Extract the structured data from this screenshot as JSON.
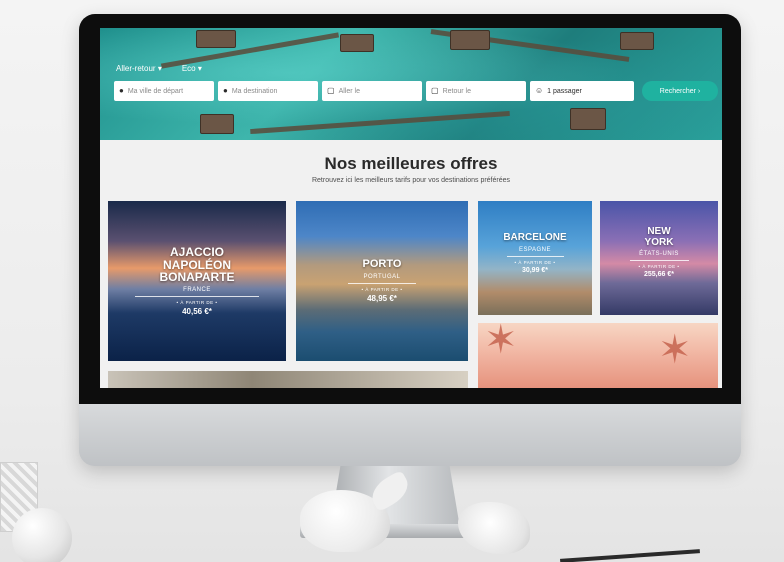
{
  "search": {
    "trip_type": "Aller-retour",
    "trip_type_caret": "▾",
    "cabin": "Eco",
    "cabin_caret": "▾",
    "departure_placeholder": "Ma ville de départ",
    "destination_placeholder": "Ma destination",
    "outbound_placeholder": "Aller le",
    "return_placeholder": "Retour le",
    "passengers": "1 passager",
    "button": "Rechercher ›",
    "icons": {
      "departure": "map-pin-icon",
      "destination": "map-pin-icon",
      "outbound": "calendar-icon",
      "return": "calendar-icon",
      "passengers": "users-icon"
    }
  },
  "offers": {
    "title": "Nos meilleures offres",
    "subtitle": "Retrouvez ici les meilleurs tarifs pour vos destinations préférées",
    "cards": [
      {
        "city": "AJACCIO NAPOLÉON BONAPARTE",
        "country": "FRANCE",
        "from_label": "• À PARTIR DE •",
        "price": "40,56 €*"
      },
      {
        "city": "PORTO",
        "country": "PORTUGAL",
        "from_label": "• À PARTIR DE •",
        "price": "48,95 €*"
      },
      {
        "city": "BARCELONE",
        "country": "ESPAGNE",
        "from_label": "• À PARTIR DE •",
        "price": "30,99 €*"
      },
      {
        "city": "NEW YORK",
        "country": "ÉTATS-UNIS",
        "from_label": "• À PARTIR DE •",
        "price": "255,66 €*"
      }
    ]
  },
  "colors": {
    "accent": "#1fb2a0",
    "hero": "#2aa39c",
    "page_bg": "#f1f1f1"
  }
}
